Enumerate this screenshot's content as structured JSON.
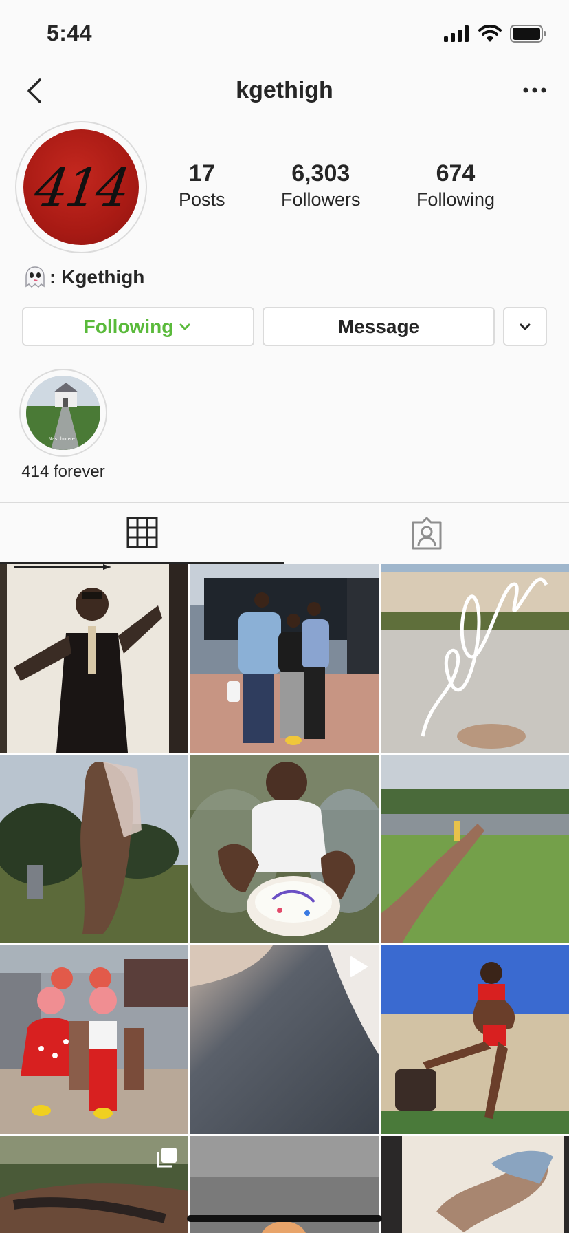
{
  "status_bar": {
    "time": "5:44",
    "icons": [
      "signal-icon",
      "wifi-icon",
      "battery-icon"
    ]
  },
  "nav": {
    "title": "kgethigh",
    "back_icon": "chevron-left-icon",
    "more_icon": "ellipsis-icon"
  },
  "profile": {
    "avatar_text": "414",
    "stats": [
      {
        "value": "17",
        "label": "Posts"
      },
      {
        "value": "6,303",
        "label": "Followers"
      },
      {
        "value": "674",
        "label": "Following"
      }
    ],
    "bio": ": Kgethigh",
    "bio_icon": "ghost-emoji-icon"
  },
  "buttons": {
    "following": "Following",
    "message": "Message"
  },
  "highlights": [
    {
      "label": "414 forever",
      "caption": "Nas house."
    }
  ],
  "tabs": [
    {
      "name": "grid",
      "icon": "grid-icon",
      "active": true
    },
    {
      "name": "tagged",
      "icon": "tagged-person-icon",
      "active": false
    }
  ],
  "colors": {
    "following_green": "#5aba3b",
    "text": "#262626",
    "border": "#dbdbdb",
    "background": "#fafafa"
  },
  "posts": [
    {
      "id": "post-1",
      "type": "photo"
    },
    {
      "id": "post-2",
      "type": "photo"
    },
    {
      "id": "post-3",
      "type": "photo"
    },
    {
      "id": "post-4",
      "type": "photo"
    },
    {
      "id": "post-5",
      "type": "photo"
    },
    {
      "id": "post-6",
      "type": "photo"
    },
    {
      "id": "post-7",
      "type": "photo"
    },
    {
      "id": "post-8",
      "type": "video"
    },
    {
      "id": "post-9",
      "type": "photo"
    },
    {
      "id": "post-10",
      "type": "carousel"
    },
    {
      "id": "post-11",
      "type": "photo"
    },
    {
      "id": "post-12",
      "type": "photo"
    }
  ]
}
